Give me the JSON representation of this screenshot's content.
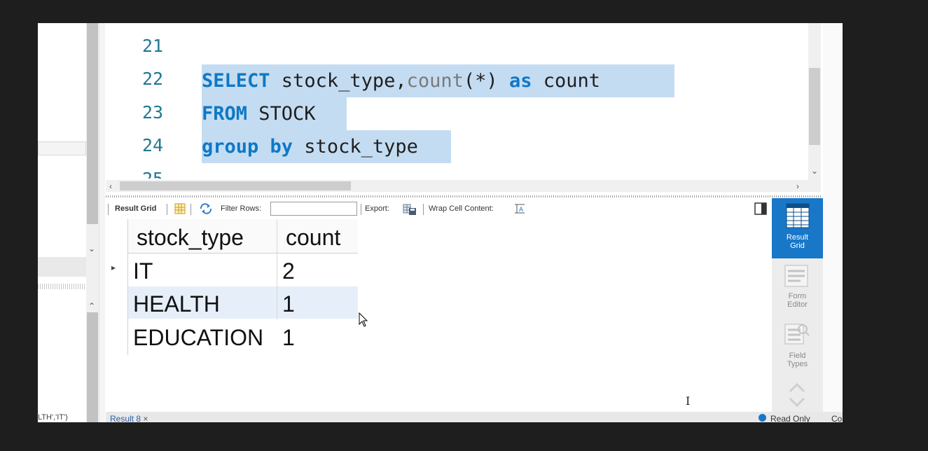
{
  "editor": {
    "lines": [
      {
        "num": "21"
      },
      {
        "num": "22"
      },
      {
        "num": "23"
      },
      {
        "num": "24"
      },
      {
        "num": "25"
      }
    ],
    "line22": {
      "select": "SELECT",
      "cols": " stock_type,",
      "fn": "count",
      "star": "(*) ",
      "as": "as",
      "alias": " count "
    },
    "line23": {
      "from": "FROM",
      "table": " STOCK "
    },
    "line24": {
      "group": "group by",
      "col": " stock_type"
    }
  },
  "toolbar": {
    "result_grid": "Result Grid",
    "filter_rows": "Filter Rows:",
    "filter_value": "",
    "export": "Export:",
    "wrap_cell": "Wrap Cell Content:"
  },
  "grid": {
    "columns": [
      "stock_type",
      "count"
    ],
    "rows": [
      [
        "IT",
        "2"
      ],
      [
        "HEALTH",
        "1"
      ],
      [
        "EDUCATION",
        "1"
      ]
    ]
  },
  "side_panel": {
    "result_grid": [
      "Result",
      "Grid"
    ],
    "form_editor": [
      "Form",
      "Editor"
    ],
    "field_types": [
      "Field",
      "Types"
    ]
  },
  "bottom": {
    "left_snippet": "LTH','IT')",
    "result_tab": "Result 8",
    "close": "×",
    "read_only": "Read Only",
    "co": "Co"
  },
  "colors": {
    "accent": "#1977c8",
    "keyword": "#0e78c6",
    "selection": "#c4dcf2"
  }
}
